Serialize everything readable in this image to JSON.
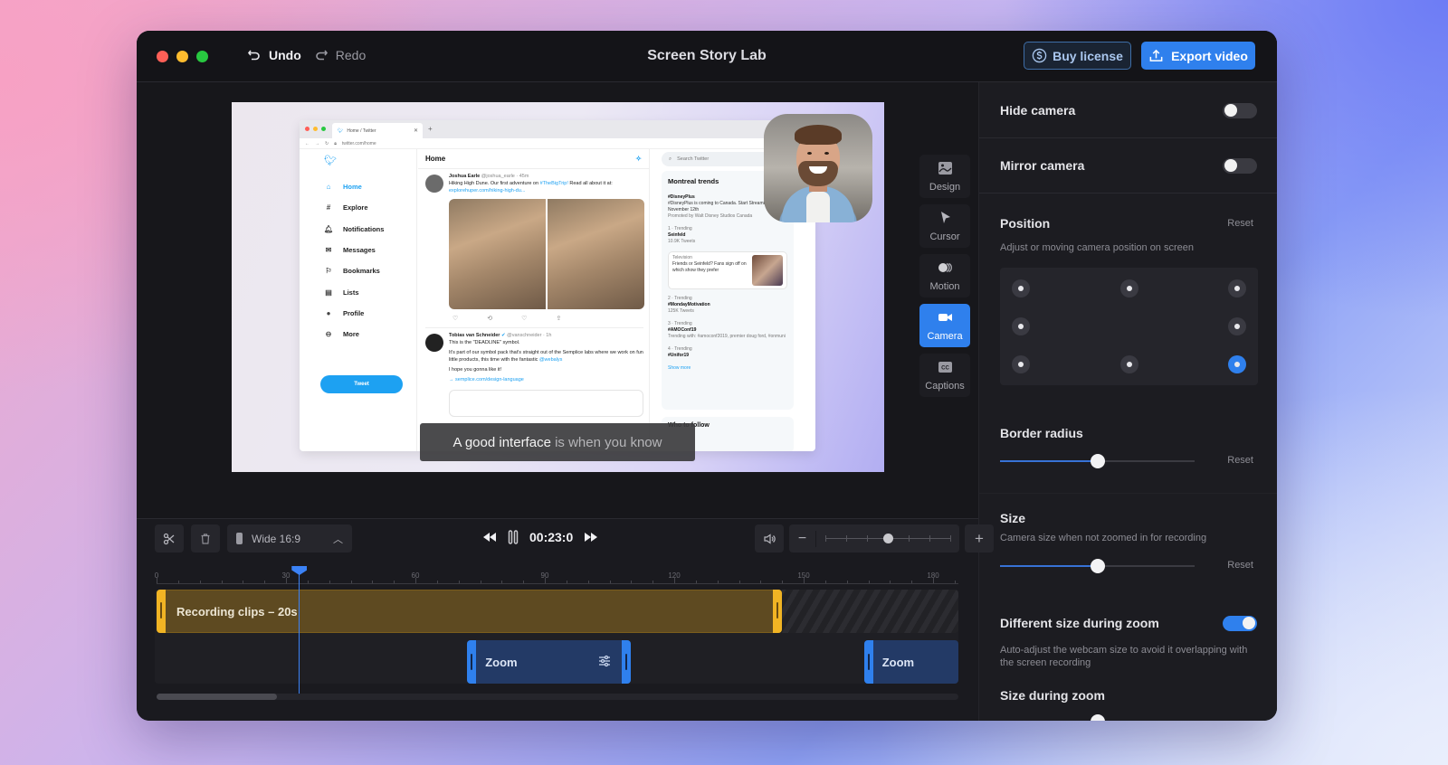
{
  "window": {
    "title": "Screen Story Lab",
    "undo_label": "Undo",
    "redo_label": "Redo",
    "buy_license_label": "Buy license",
    "export_label": "Export video"
  },
  "preview": {
    "browser": {
      "tab_title": "Home / Twitter",
      "url": "twitter.com/home",
      "nav": [
        {
          "label": "Home",
          "icon": "home-icon",
          "glyph": "⌂",
          "active": true
        },
        {
          "label": "Explore",
          "icon": "hashtag-icon",
          "glyph": "#",
          "active": false
        },
        {
          "label": "Notifications",
          "icon": "bell-icon",
          "glyph": "🔔︎",
          "active": false
        },
        {
          "label": "Messages",
          "icon": "mail-icon",
          "glyph": "✉",
          "active": false
        },
        {
          "label": "Bookmarks",
          "icon": "bookmark-icon",
          "glyph": "⚐",
          "active": false
        },
        {
          "label": "Lists",
          "icon": "list-icon",
          "glyph": "▤",
          "active": false
        },
        {
          "label": "Profile",
          "icon": "profile-icon",
          "glyph": "●",
          "active": false
        },
        {
          "label": "More",
          "icon": "more-icon",
          "glyph": "⊖",
          "active": false
        }
      ],
      "tweet_button": "Tweet",
      "feed_title": "Home",
      "tweets": [
        {
          "name": "Joshua Earle",
          "handle": "@joshua_earle · 45m",
          "text": "Hiking High Dune. Our first adventure on ",
          "hashtag": "#TheBigTrip!",
          "text2": " Read all about it at:",
          "link": "explorehuper.com/hiking-high-du..."
        },
        {
          "name": "Tobias van Schneider",
          "handle": "@vanschneider · 1h",
          "text": "This is the \"DEADLINE\" symbol.",
          "text2": "It's part of our symbol pack that's straight out of the Semplice labs where we work on fun little products, this time with the fantastic ",
          "mention": "@webalys",
          "text3": "I hope you gonna like it!",
          "link": "→ semplice.com/design-language"
        }
      ],
      "search_placeholder": "Search Twitter",
      "trends_title": "Montreal trends",
      "trends": [
        {
          "meta": "",
          "tag": "#DisneyPlus",
          "desc": "#DisneyPlus is coming to Canada. Start Streaming November 12th",
          "extra": "Promoted by Walt Disney Studios Canada"
        },
        {
          "meta": "1 · Trending",
          "tag": "Seinfeld",
          "desc": "10.9K Tweets"
        },
        {
          "meta": "2 · Trending",
          "tag": "#MondayMotivation",
          "desc": "125K Tweets"
        },
        {
          "meta": "3 · Trending",
          "tag": "#AMOConf19",
          "desc": "Trending with: #amoconf2019, premier doug ford, #onmuni"
        },
        {
          "meta": "4 · Trending",
          "tag": "#Unifor19",
          "desc": ""
        }
      ],
      "trend_card": {
        "category": "Television",
        "text": "Friends or Seinfeld? Fans sign off on which show they prefer"
      },
      "show_more": "Show more",
      "follow_title": "Who to follow"
    },
    "caption_spoken": "A good interface",
    "caption_rest": " is when you know"
  },
  "rail": [
    {
      "label": "Design",
      "icon": "image-icon",
      "active": false
    },
    {
      "label": "Cursor",
      "icon": "cursor-icon",
      "active": false
    },
    {
      "label": "Motion",
      "icon": "motion-icon",
      "active": false
    },
    {
      "label": "Camera",
      "icon": "camera-icon",
      "active": true
    },
    {
      "label": "Captions",
      "icon": "captions-icon",
      "active": false
    }
  ],
  "panel": {
    "hide_camera": {
      "label": "Hide camera",
      "on": false
    },
    "mirror_camera": {
      "label": "Mirror camera",
      "on": false
    },
    "position": {
      "label": "Position",
      "reset": "Reset",
      "description": "Adjust or moving camera position on screen",
      "selected": "bottom-right"
    },
    "border_radius": {
      "label": "Border radius",
      "reset": "Reset",
      "value_percent": 50
    },
    "size": {
      "label": "Size",
      "description": "Camera size when not zoomed in for recording",
      "reset": "Reset",
      "value_percent": 50
    },
    "different_size": {
      "label": "Different size during zoom",
      "on": true,
      "description": "Auto-adjust the webcam size to avoid it overlapping with the screen recording"
    },
    "size_during_zoom": {
      "label": "Size during zoom"
    }
  },
  "timeline": {
    "aspect_label": "Wide 16:9",
    "time": "00:23:0",
    "zoom_level_percent": 50,
    "ruler_labels": [
      "0",
      "30",
      "60",
      "90",
      "120",
      "150",
      "180"
    ],
    "playhead_seconds": 33,
    "recording_clip": {
      "label": "Recording clips – 20s",
      "start": 0,
      "end": 145
    },
    "zoom_clips": [
      {
        "label": "Zoom",
        "start": 72,
        "end": 110,
        "has_settings": true
      },
      {
        "label": "Zoom",
        "start": 164,
        "end": 190,
        "has_settings": false
      }
    ],
    "scroll_fraction": 0.15
  }
}
